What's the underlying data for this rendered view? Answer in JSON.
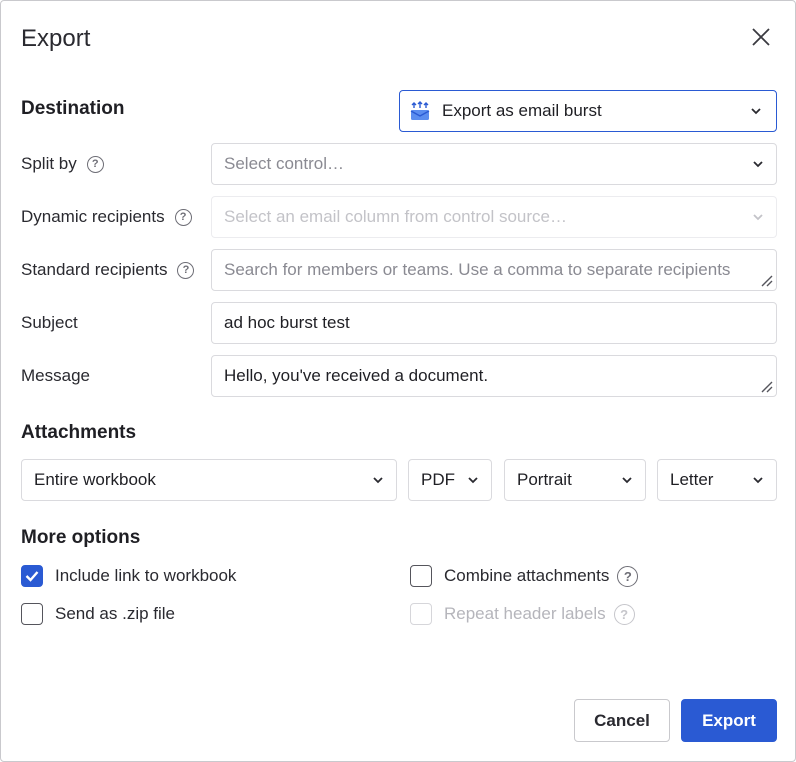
{
  "dialog": {
    "title": "Export"
  },
  "destination": {
    "label": "Destination",
    "selected": "Export as email burst"
  },
  "fields": {
    "split_by": {
      "label": "Split by",
      "placeholder": "Select control…"
    },
    "dynamic_recipients": {
      "label": "Dynamic recipients",
      "placeholder": "Select an email column from control source…"
    },
    "standard_recipients": {
      "label": "Standard recipients",
      "placeholder": "Search for members or teams. Use a comma to separate recipients"
    },
    "subject": {
      "label": "Subject",
      "value": "ad hoc burst test"
    },
    "message": {
      "label": "Message",
      "value": "Hello, you've received a document."
    }
  },
  "attachments": {
    "label": "Attachments",
    "scope": "Entire workbook",
    "format": "PDF",
    "orientation": "Portrait",
    "paper": "Letter"
  },
  "more_options": {
    "label": "More options",
    "include_link": {
      "label": "Include link to workbook",
      "checked": true
    },
    "send_zip": {
      "label": "Send as .zip file",
      "checked": false
    },
    "combine": {
      "label": "Combine attachments",
      "checked": false
    },
    "repeat_headers": {
      "label": "Repeat header labels",
      "checked": false,
      "disabled": true
    }
  },
  "buttons": {
    "cancel": "Cancel",
    "export": "Export"
  },
  "colors": {
    "accent": "#2a5ad3"
  }
}
